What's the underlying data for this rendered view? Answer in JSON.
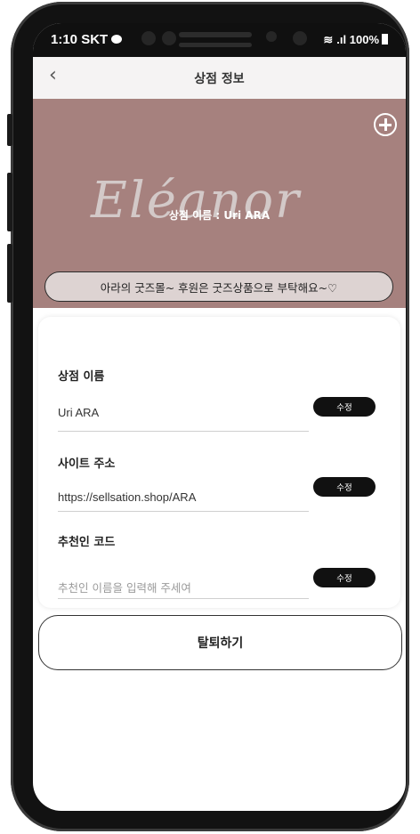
{
  "status_bar": {
    "time": "1:10",
    "carrier": "SKT",
    "battery": "100%"
  },
  "header": {
    "back_icon": "chevron-left-icon",
    "title": "상점 정보"
  },
  "banner": {
    "script_text": "Eléanor",
    "store_name_line": "상점 이름 : Uri ARA",
    "intro": "아라의 굿즈몰~ 후원은 굿즈상품으로 부탁해요~♡",
    "background_color": "#a6817e"
  },
  "fields": [
    {
      "label": "상점 이름",
      "value": "Uri ARA",
      "button": "수정"
    },
    {
      "label": "사이트 주소",
      "value": "https://sellsation.shop/ARA",
      "button": "수정"
    },
    {
      "label": "추천인 코드",
      "placeholder": "추천인 이름을 입력해 주세여",
      "button": "수정"
    }
  ],
  "withdraw_label": "탈퇴하기"
}
